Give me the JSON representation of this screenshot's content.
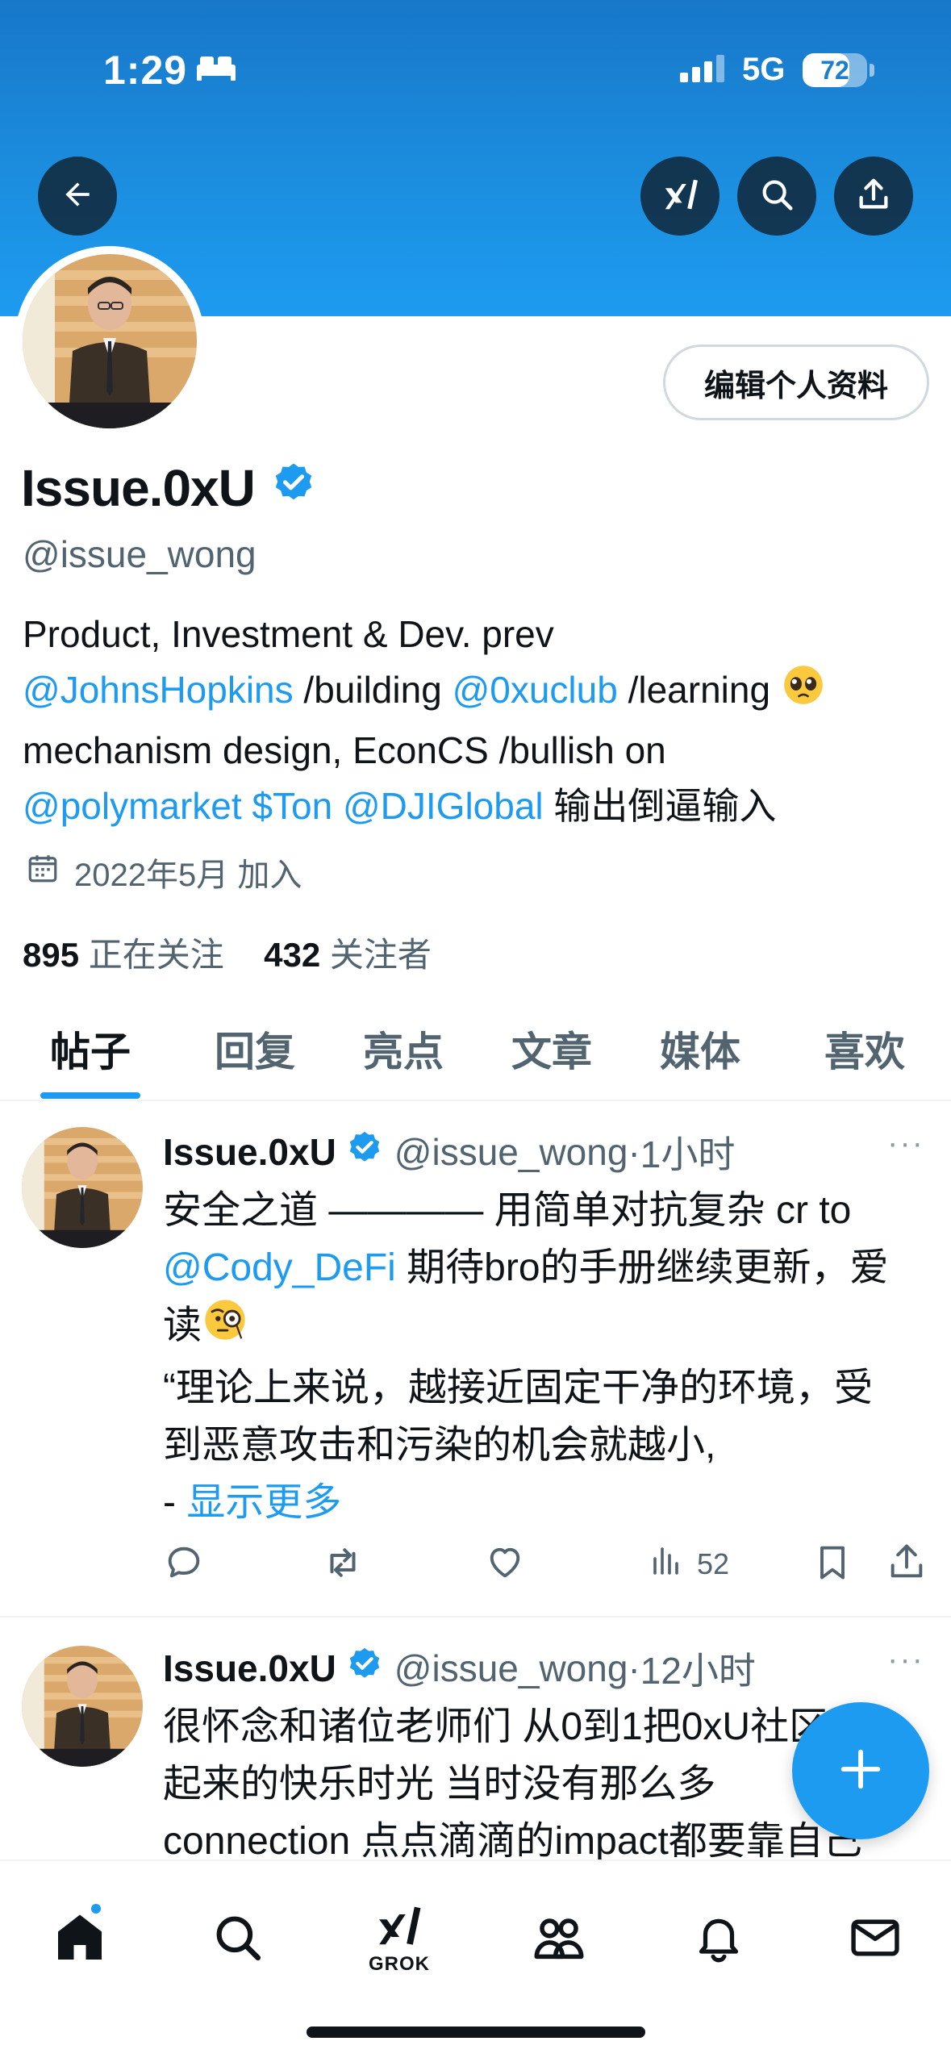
{
  "status_bar": {
    "time": "1:29",
    "network": "5G",
    "battery_percent": "72",
    "battery_level": 0.72
  },
  "header": {
    "back_icon": "arrow-left-icon",
    "grok_icon": "grok-logo-icon",
    "search_icon": "search-icon",
    "share_icon": "share-icon"
  },
  "profile": {
    "edit_label": "编辑个人资料",
    "display_name": "Issue.0xU",
    "handle": "@issue_wong",
    "verified_color": "#1d9bf0",
    "bio": {
      "line1": "Product, Investment & Dev. prev",
      "mention_johns": "@JohnsHopkins",
      "text_building": " /building ",
      "mention_0xuclub": "@0xuclub",
      "text_learning": " /learning ",
      "line3": "mechanism design, EconCS /bullish on",
      "mention_polymarket": "@polymarket",
      "cashtag_ton": "$Ton",
      "mention_dji": "@DJIGlobal",
      "text_tail": " 输出倒逼输入"
    },
    "joined": "2022年5月 加入",
    "following_count": "895",
    "following_label": "正在关注",
    "followers_count": "432",
    "followers_label": "关注者"
  },
  "tabs": [
    "帖子",
    "回复",
    "亮点",
    "文章",
    "媒体",
    "喜欢"
  ],
  "posts": [
    {
      "name": "Issue.0xU",
      "handle": "@issue_wong",
      "dot": "·",
      "time": "1小时",
      "more": "···",
      "text_line1": "安全之道 ———— 用简单对抗复杂 cr to",
      "mention": "@Cody_DeFi",
      "text_line2_tail": " 期待bro的手册继续更新，爱",
      "text_line3": "读",
      "text_line4": "“理论上来说，越接近固定干净的环境，受",
      "text_line5": "到恶意攻击和污染的机会就越小,",
      "show_more_prefix": "- ",
      "show_more": "显示更多",
      "views": "52"
    },
    {
      "name": "Issue.0xU",
      "handle": "@issue_wong",
      "dot": "·",
      "time": "12小时",
      "more": "···",
      "text_line1": "很怀念和诸位老师们 从0到1把0xU社区做",
      "text_line2": "起来的快乐时光 当时没有那么多",
      "text_line3": "connection 点点滴滴的impact都要靠自己"
    }
  ],
  "bottom_nav": {
    "grok_label": "GROK",
    "icons": [
      "home-icon",
      "search-icon",
      "grok-icon",
      "communities-icon",
      "notifications-icon",
      "messages-icon"
    ]
  },
  "accent_color": "#1d9bf0"
}
